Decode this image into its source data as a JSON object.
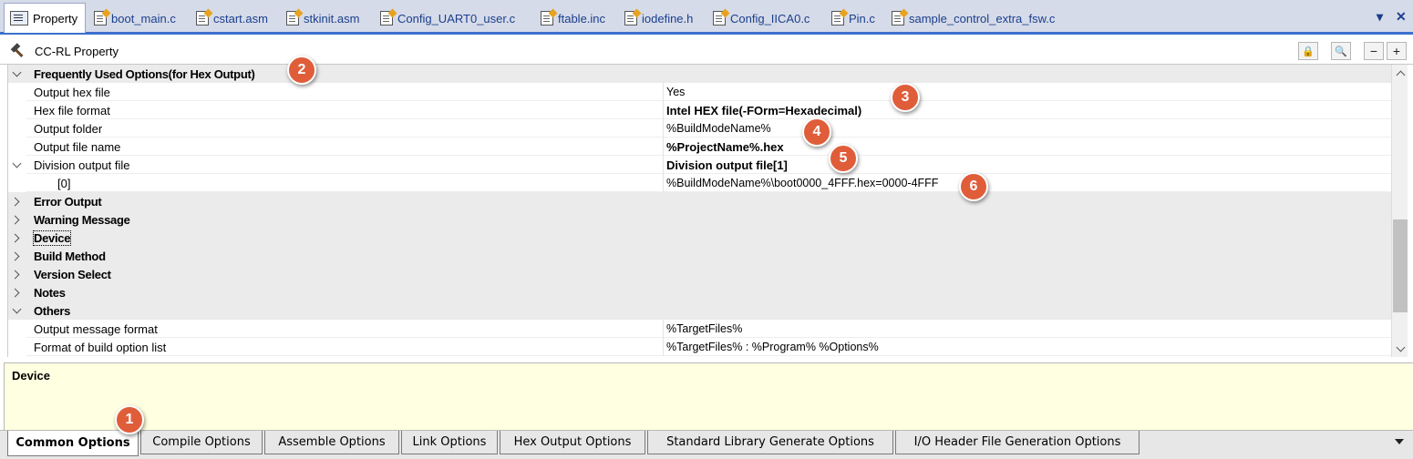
{
  "doc_tabs": [
    {
      "label": "Property",
      "icon": "property-icon",
      "active": true
    },
    {
      "label": "boot_main.c",
      "icon": "c-file-icon"
    },
    {
      "label": "cstart.asm",
      "icon": "asm-file-icon"
    },
    {
      "label": "stkinit.asm",
      "icon": "asm-file-icon"
    },
    {
      "label": "Config_UART0_user.c",
      "icon": "c-file-icon"
    },
    {
      "label": "ftable.inc",
      "icon": "inc-file-icon"
    },
    {
      "label": "iodefine.h",
      "icon": "h-file-icon"
    },
    {
      "label": "Config_IICA0.c",
      "icon": "c-file-icon"
    },
    {
      "label": "Pin.c",
      "icon": "c-file-icon"
    },
    {
      "label": "sample_control_extra_fsw.c",
      "icon": "c-file-icon"
    }
  ],
  "doc_tab_controls": {
    "dropdown": "▾",
    "close": "✕"
  },
  "prop_header": {
    "title": "CC-RL Property",
    "buttons": {
      "lock": "🔒",
      "search": "🔍",
      "collapse": "−",
      "expand": "+"
    }
  },
  "grid": {
    "rows": [
      {
        "type": "category",
        "expanded": true,
        "name": "Frequently Used Options(for Hex Output)"
      },
      {
        "type": "item",
        "name": "Output hex file",
        "value": "Yes",
        "bold": false
      },
      {
        "type": "item",
        "name": "Hex file format",
        "value": "Intel HEX file(-FOrm=Hexadecimal)",
        "bold": true
      },
      {
        "type": "item",
        "name": "Output folder",
        "value": "%BuildModeName%",
        "bold": false
      },
      {
        "type": "item",
        "name": "Output file name",
        "value": "%ProjectName%.hex",
        "bold": true
      },
      {
        "type": "item-expandable",
        "expanded": true,
        "name": "Division output file",
        "value": "Division output file[1]",
        "bold": true
      },
      {
        "type": "subitem",
        "name": "[0]",
        "value": "%BuildModeName%\\boot0000_4FFF.hex=0000-4FFF",
        "bold": false
      },
      {
        "type": "category",
        "expanded": false,
        "name": "Error Output"
      },
      {
        "type": "category",
        "expanded": false,
        "name": "Warning Message"
      },
      {
        "type": "category",
        "expanded": false,
        "name": "Device"
      },
      {
        "type": "category",
        "expanded": false,
        "name": "Build Method"
      },
      {
        "type": "category",
        "expanded": false,
        "name": "Version Select"
      },
      {
        "type": "category",
        "expanded": false,
        "name": "Notes"
      },
      {
        "type": "category",
        "expanded": true,
        "name": "Others"
      },
      {
        "type": "item",
        "name": "Output message format",
        "value": "%TargetFiles%",
        "bold": false
      },
      {
        "type": "item",
        "name": "Format of build option list",
        "value": "%TargetFiles% : %Program% %Options%",
        "bold": false
      }
    ]
  },
  "description": {
    "title": "Device"
  },
  "bottom_tabs": [
    {
      "label": "Common Options",
      "active": true
    },
    {
      "label": "Compile Options"
    },
    {
      "label": "Assemble Options"
    },
    {
      "label": "Link Options"
    },
    {
      "label": "Hex Output Options"
    },
    {
      "label": "Standard Library Generate Options"
    },
    {
      "label": "I/O Header File Generation Options"
    }
  ],
  "callouts": [
    "1",
    "2",
    "3",
    "4",
    "5",
    "6"
  ],
  "colors": {
    "accent": "#3c6fce",
    "callout": "#e05d3a",
    "description_bg": "#ffffe1",
    "category_bg": "#ebebeb"
  }
}
